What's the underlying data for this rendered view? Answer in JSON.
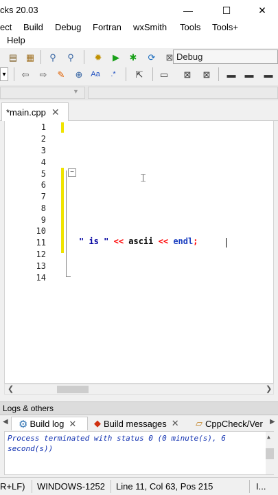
{
  "window": {
    "title": "cks 20.03",
    "minimize": "—",
    "maximize": "☐",
    "close": "✕"
  },
  "menu": {
    "items": [
      "ect",
      "Build",
      "Debug",
      "Fortran",
      "wxSmith",
      "Tools",
      "Tools+"
    ],
    "help": "Help"
  },
  "toolbar": {
    "build_target": "Debug",
    "icons": {
      "row1": [
        "paste-icon",
        "clipboard-icon",
        "find-icon",
        "replace-icon",
        "settings-icon",
        "run-icon",
        "build-and-run-icon",
        "rebuild-icon",
        "abort-icon"
      ],
      "row2": [
        "back-icon",
        "forward-icon",
        "highlight-icon",
        "toggle-icon",
        "match-case-icon",
        "regex-icon",
        "select-icon",
        "rect-icon",
        "doc-a-icon",
        "doc-b-icon",
        "block-a-icon",
        "block-b-icon"
      ]
    }
  },
  "editor": {
    "tab_label": "*main.cpp",
    "tab_close": "✕",
    "line_numbers": [
      "1",
      "2",
      "3",
      "4",
      "5",
      "6",
      "7",
      "8",
      "9",
      "10",
      "11",
      "12",
      "13",
      "14"
    ],
    "code": {
      "string_part": "\" is \"",
      "op1": "<<",
      "ident": "ascii",
      "op2": "<<",
      "keyword": "endl",
      "semicolon": ";"
    },
    "fold_marker": "−",
    "colors": {
      "changed_bar": "#f0e400",
      "string": "#0000a0",
      "operator": "#ff0000",
      "keyword": "#1a3ec0"
    }
  },
  "logs": {
    "header": "Logs & others",
    "tabs": [
      {
        "label": "Build log",
        "icon": "gear-icon"
      },
      {
        "label": "Build messages",
        "icon": "bug-icon"
      },
      {
        "label": "CppCheck/Ver",
        "icon": "document-icon"
      }
    ],
    "close_glyph": "✕",
    "message": "Process terminated with status 0 (0 minute(s), 6 second(s))"
  },
  "status": {
    "eol": "R+LF)",
    "encoding": "WINDOWS-1252",
    "position": "Line 11, Col 63, Pos 215",
    "extra": "I..."
  }
}
